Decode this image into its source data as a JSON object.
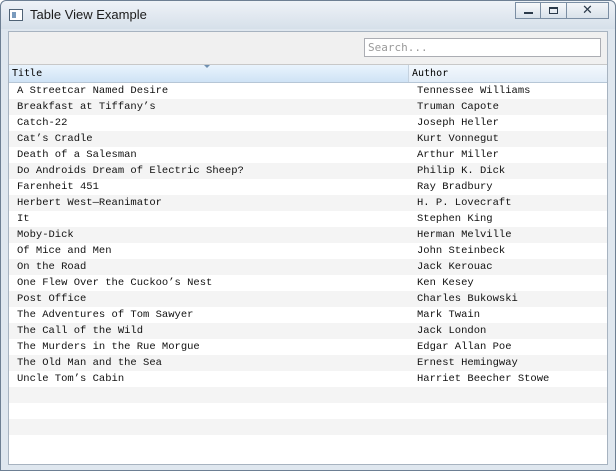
{
  "window": {
    "title": "Table View Example",
    "close_glyph": "✕"
  },
  "search": {
    "placeholder": "Search...",
    "value": ""
  },
  "table": {
    "columns": [
      "Title",
      "Author"
    ],
    "sorted_column": "Title",
    "rows": [
      {
        "title": "A Streetcar Named Desire",
        "author": "Tennessee Williams"
      },
      {
        "title": "Breakfast at Tiffany’s",
        "author": "Truman Capote"
      },
      {
        "title": "Catch-22",
        "author": "Joseph Heller"
      },
      {
        "title": "Cat’s Cradle",
        "author": "Kurt Vonnegut"
      },
      {
        "title": "Death of a Salesman",
        "author": "Arthur Miller"
      },
      {
        "title": "Do Androids Dream of Electric Sheep?",
        "author": "Philip K. Dick"
      },
      {
        "title": "Farenheit 451",
        "author": "Ray Bradbury"
      },
      {
        "title": "Herbert West—Reanimator",
        "author": "H. P. Lovecraft"
      },
      {
        "title": "It",
        "author": "Stephen King"
      },
      {
        "title": "Moby-Dick",
        "author": "Herman Melville"
      },
      {
        "title": "Of Mice and Men",
        "author": "John Steinbeck"
      },
      {
        "title": "On the Road",
        "author": "Jack Kerouac"
      },
      {
        "title": "One Flew Over the Cuckoo’s Nest",
        "author": "Ken Kesey"
      },
      {
        "title": "Post Office",
        "author": "Charles Bukowski"
      },
      {
        "title": "The Adventures of Tom Sawyer",
        "author": "Mark Twain"
      },
      {
        "title": "The Call of the Wild",
        "author": "Jack London"
      },
      {
        "title": "The Murders in the Rue Morgue",
        "author": "Edgar Allan Poe"
      },
      {
        "title": "The Old Man and the Sea",
        "author": "Ernest Hemingway"
      },
      {
        "title": "Uncle Tom’s Cabin",
        "author": "Harriet Beecher Stowe"
      }
    ]
  },
  "colors": {
    "row_stripe": "#f4f4f4",
    "header_bg": "#e1ecf7",
    "window_frame": "#dfe7ef"
  }
}
